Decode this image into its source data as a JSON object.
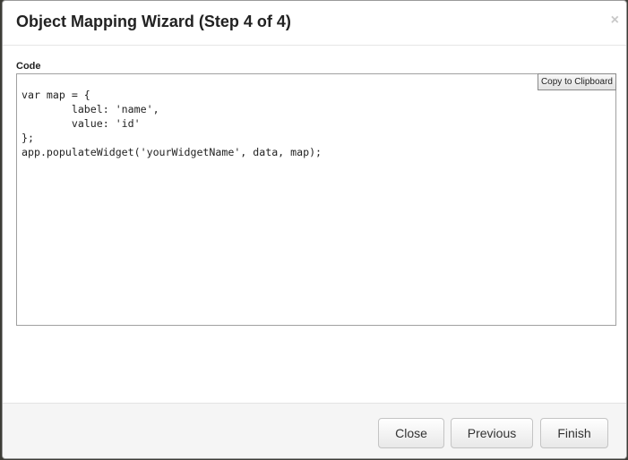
{
  "dialog": {
    "title": "Object Mapping Wizard (Step 4 of 4)",
    "close_glyph": "×"
  },
  "code_section": {
    "label": "Code",
    "copy_button": "Copy to Clipboard",
    "lines": [
      "var map = {",
      "        label: 'name',",
      "        value: 'id'",
      "};",
      "app.populateWidget('yourWidgetName', data, map);"
    ]
  },
  "footer": {
    "close_label": "Close",
    "previous_label": "Previous",
    "finish_label": "Finish"
  }
}
